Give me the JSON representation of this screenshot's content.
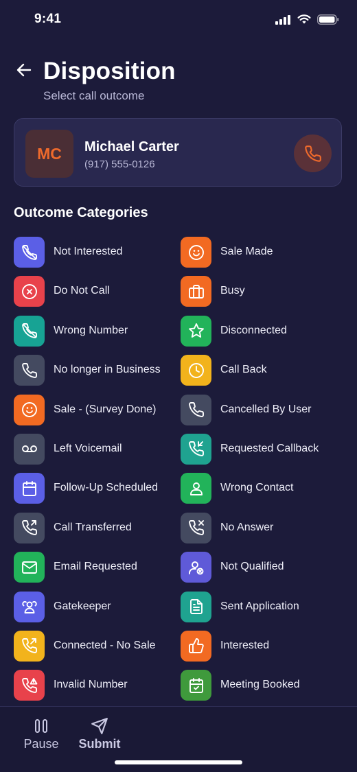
{
  "status_bar": {
    "time": "9:41"
  },
  "header": {
    "title": "Disposition",
    "subtitle": "Select call outcome"
  },
  "contact": {
    "initials": "MC",
    "name": "Michael Carter",
    "phone": "(917) 555-0126"
  },
  "section_title": "Outcome Categories",
  "outcomes": [
    {
      "label": "Not Interested",
      "icon": "phone-slash-icon",
      "color": "#5b5fe6"
    },
    {
      "label": "Sale Made",
      "icon": "smile-icon",
      "color": "#f26a22"
    },
    {
      "label": "Do Not Call",
      "icon": "x-circle-icon",
      "color": "#e8424b"
    },
    {
      "label": "Busy",
      "icon": "briefcase-icon",
      "color": "#f26a22"
    },
    {
      "label": "Wrong Number",
      "icon": "phone-slash-icon",
      "color": "#17a394"
    },
    {
      "label": "Disconnected",
      "icon": "star-icon",
      "color": "#22b35a"
    },
    {
      "label": "No longer in Business",
      "icon": "phone-icon",
      "color": "#444a60"
    },
    {
      "label": "Call Back",
      "icon": "clock-icon",
      "color": "#f2b31c"
    },
    {
      "label": "Sale - (Survey Done)",
      "icon": "smile-icon",
      "color": "#f26a22"
    },
    {
      "label": "Cancelled By User",
      "icon": "phone-icon",
      "color": "#444a60"
    },
    {
      "label": "Left Voicemail",
      "icon": "voicemail-icon",
      "color": "#444a60"
    },
    {
      "label": "Requested Callback",
      "icon": "phone-callback-icon",
      "color": "#1fa390"
    },
    {
      "label": "Follow-Up Scheduled",
      "icon": "calendar-icon",
      "color": "#5b5fe6"
    },
    {
      "label": "Wrong Contact",
      "icon": "user-icon",
      "color": "#22b35a"
    },
    {
      "label": "Call Transferred",
      "icon": "phone-forward-icon",
      "color": "#444a60"
    },
    {
      "label": "No Answer",
      "icon": "phone-missed-icon",
      "color": "#444a60"
    },
    {
      "label": "Email Requested",
      "icon": "mail-icon",
      "color": "#22b35a"
    },
    {
      "label": "Not Qualified",
      "icon": "user-x-icon",
      "color": "#5f5ad8"
    },
    {
      "label": "Gatekeeper",
      "icon": "users-icon",
      "color": "#5b5fe6"
    },
    {
      "label": "Sent Application",
      "icon": "document-icon",
      "color": "#1fa390"
    },
    {
      "label": "Connected - No Sale",
      "icon": "phone-outgoing-icon",
      "color": "#f2b31c"
    },
    {
      "label": "Interested",
      "icon": "thumbs-up-icon",
      "color": "#f26a22"
    },
    {
      "label": "Invalid Number",
      "icon": "phone-alert-icon",
      "color": "#e8424b"
    },
    {
      "label": "Meeting Booked",
      "icon": "calendar-check-icon",
      "color": "#3f9a3c"
    }
  ],
  "bottom_bar": {
    "pause_label": "Pause",
    "submit_label": "Submit"
  }
}
